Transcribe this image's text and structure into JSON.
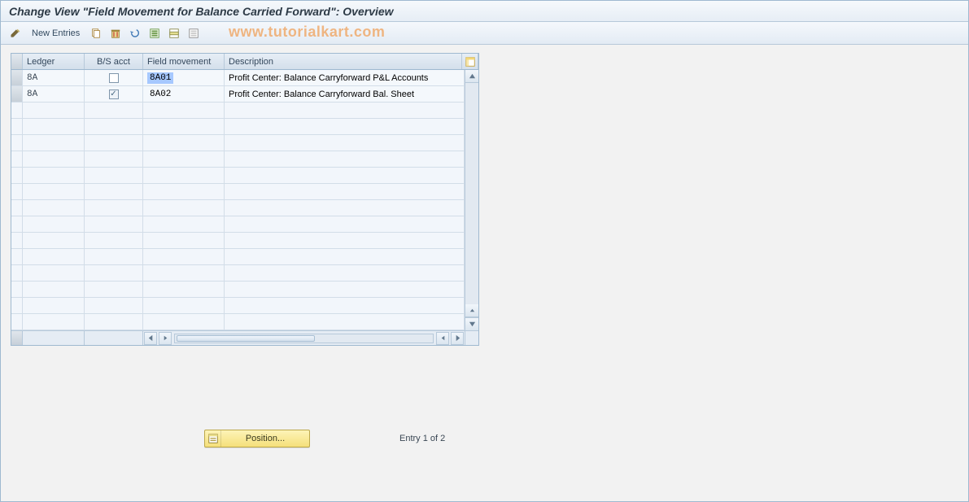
{
  "title": "Change View \"Field Movement for Balance Carried Forward\": Overview",
  "toolbar": {
    "new_entries_label": "New Entries"
  },
  "watermark": "www.tutorialkart.com",
  "table": {
    "columns": {
      "ledger": "Ledger",
      "bsacct": "B/S acct",
      "fmove": "Field movement",
      "desc": "Description"
    },
    "rows": [
      {
        "ledger": "8A",
        "bsacct_checked": false,
        "fmove": "8A01",
        "fmove_highlight": true,
        "desc": "Profit Center: Balance Carryforward P&L Accounts"
      },
      {
        "ledger": "8A",
        "bsacct_checked": true,
        "fmove": "8A02",
        "fmove_highlight": false,
        "desc": "Profit Center: Balance Carryforward Bal. Sheet"
      }
    ],
    "empty_rows": 14
  },
  "footer": {
    "position_label": "Position...",
    "entry_text": "Entry 1 of 2"
  }
}
